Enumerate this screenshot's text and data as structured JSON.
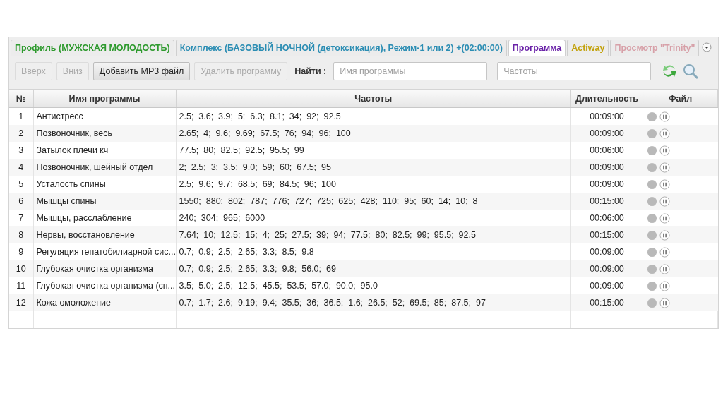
{
  "tabs": [
    {
      "label": "Профиль (МУЖСКАЯ МОЛОДОСТЬ)",
      "color": "#2e9a2e",
      "selected": false
    },
    {
      "label": "Комплекс (БАЗОВЫЙ НОЧНОЙ (детоксикация), Режим-1 или 2) +(02:00:00)",
      "color": "#2b8db3",
      "selected": false
    },
    {
      "label": "Программа",
      "color": "#6a22a8",
      "selected": true
    },
    {
      "label": "Actiway",
      "color": "#c2a10a",
      "selected": false
    },
    {
      "label": "Просмотр  \"Trinity\"",
      "color": "#d7a0a8",
      "selected": false
    }
  ],
  "toolbar": {
    "buttons": [
      {
        "label": "Вверх",
        "disabled": true
      },
      {
        "label": "Вниз",
        "disabled": true
      },
      {
        "label": "Добавить MP3 файл",
        "disabled": false
      },
      {
        "label": "Удалить программу",
        "disabled": true
      }
    ],
    "find_label": "Найти  :",
    "name_search": {
      "placeholder": "Имя программы"
    },
    "freq_search": {
      "placeholder": "Частоты"
    }
  },
  "table": {
    "columns": [
      "№",
      "Имя программы",
      "Частоты",
      "Длительность",
      "Файл"
    ],
    "rows": [
      [
        "1",
        "Антистресс",
        "2.5;  3.6;  3.9;  5;  6.3;  8.1;  34;  92;  92.5",
        "00:09:00"
      ],
      [
        "2",
        "Позвоночник, весь",
        "2.65;  4;  9.6;  9.69;  67.5;  76;  94;  96;  100",
        "00:09:00"
      ],
      [
        "3",
        "Затылок плечи кч",
        "77.5;  80;  82.5;  92.5;  95.5;  99",
        "00:06:00"
      ],
      [
        "4",
        "Позвоночник, шейный отдел",
        "2;  2.5;  3;  3.5;  9.0;  59;  60;  67.5;  95",
        "00:09:00"
      ],
      [
        "5",
        "Усталость спины",
        "2.5;  9.6;  9.7;  68.5;  69;  84.5;  96;  100",
        "00:09:00"
      ],
      [
        "6",
        "Мышцы спины",
        "1550;  880;  802;  787;  776;  727;  725;  625;  428;  110;  95;  60;  14;  10;  8",
        "00:15:00"
      ],
      [
        "7",
        "Мышцы, расслабление",
        "240;  304;  965;  6000",
        "00:06:00"
      ],
      [
        "8",
        "Нервы, восстановление",
        "7.64;  10;  12.5;  15;  4;  25;  27.5;  39;  94;  77.5;  80;  82.5;  99;  95.5;  92.5",
        "00:15:00"
      ],
      [
        "9",
        "Регуляция гепатобилиарной сис...",
        "0.7;  0.9;  2.5;  2.65;  3.3;  8.5;  9.8",
        "00:09:00"
      ],
      [
        "10",
        "Глубокая очистка организма",
        "0.7;  0.9;  2.5;  2.65;  3.3;  9.8;  56.0;  69",
        "00:09:00"
      ],
      [
        "11",
        "Глубокая очистка организма (сп...",
        "3.5;  5.0;  2.5;  12.5;  45.5;  53.5;  57.0;  90.0;  95.0",
        "00:09:00"
      ],
      [
        "12",
        "Кожа омоложение",
        "0.7;  1.7;  2.6;  9.19;  9.4;  35.5;  36;  36.5;  1.6;  26.5;  52;  69.5;  85;  87.5;  97",
        "00:15:00"
      ]
    ]
  }
}
